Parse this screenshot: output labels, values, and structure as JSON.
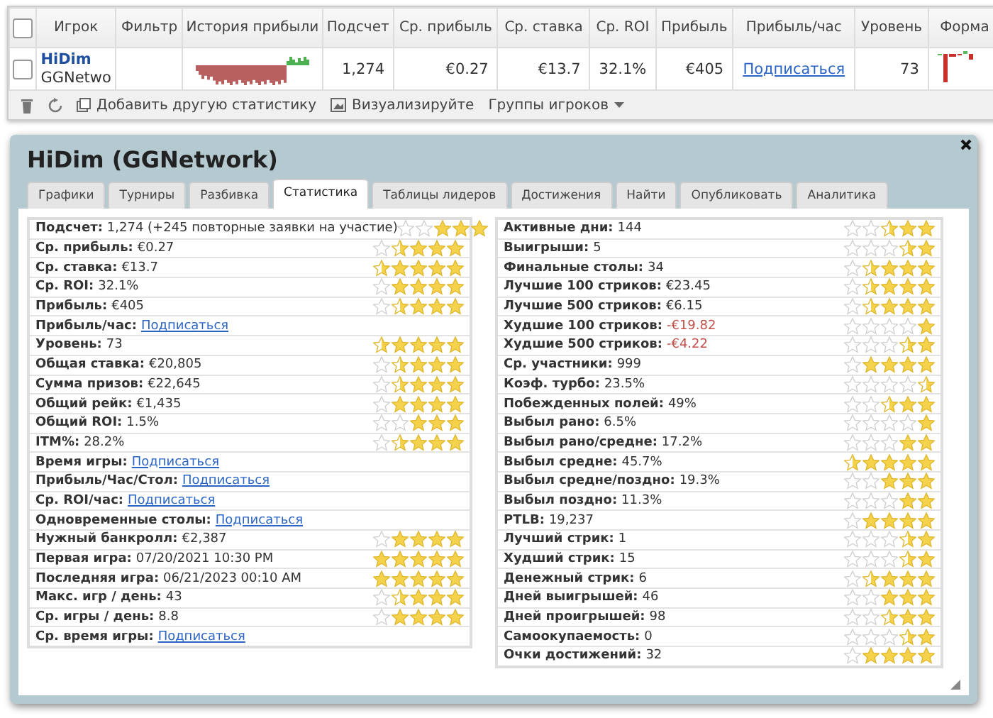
{
  "table": {
    "header_checked": false,
    "columns": [
      "Игрок",
      "Фильтр",
      "История прибыли",
      "Подсчет",
      "Ср. прибыль",
      "Ср. ставка",
      "Ср. ROI",
      "Прибыль",
      "Прибыль/час",
      "Уровень",
      "Форма"
    ],
    "row": {
      "checked": false,
      "player": "HiDim",
      "network": "GGNetwo",
      "count": "1,274",
      "avg_profit": "€0.27",
      "avg_stake": "€13.7",
      "avg_roi": "32.1%",
      "profit": "€405",
      "profit_per_hour": "Подписаться",
      "level": "73"
    }
  },
  "toolbar": {
    "add_stat": "Добавить другую статистику",
    "visualize": "Визуализируйте",
    "groups": "Группы игроков"
  },
  "dialog": {
    "title": "HiDim (GGNetwork)",
    "tabs": [
      {
        "label": "Графики",
        "selected": false
      },
      {
        "label": "Турниры",
        "selected": false
      },
      {
        "label": "Разбивка",
        "selected": false
      },
      {
        "label": "Статистика",
        "selected": true
      },
      {
        "label": "Таблицы лидеров",
        "selected": false
      },
      {
        "label": "Достижения",
        "selected": false
      },
      {
        "label": "Найти",
        "selected": false
      },
      {
        "label": "Опубликовать",
        "selected": false
      },
      {
        "label": "Аналитика",
        "selected": false
      }
    ],
    "left_stats": [
      {
        "label": "Подсчет:",
        "value": "1,274 (+245 повторные заявки на участие)",
        "negative": false,
        "stars": 3
      },
      {
        "label": "Ср. прибыль:",
        "value": "€0.27",
        "negative": false,
        "stars": 3.5
      },
      {
        "label": "Ср. ставка:",
        "value": "€13.7",
        "negative": false,
        "stars": 4.5
      },
      {
        "label": "Ср. ROI:",
        "value": "32.1%",
        "negative": false,
        "stars": 4
      },
      {
        "label": "Прибыль:",
        "value": "€405",
        "negative": false,
        "stars": 3.5
      },
      {
        "label": "Прибыль/час:",
        "link": "Подписаться"
      },
      {
        "label": "Уровень:",
        "value": "73",
        "negative": false,
        "stars": 4.5
      },
      {
        "label": "Общая ставка:",
        "value": "€20,805",
        "negative": false,
        "stars": 3.5
      },
      {
        "label": "Сумма призов:",
        "value": "€22,645",
        "negative": false,
        "stars": 3.5
      },
      {
        "label": "Общий рейк:",
        "value": "€1,435",
        "negative": false,
        "stars": 4
      },
      {
        "label": "Общий ROI:",
        "value": "1.5%",
        "negative": false,
        "stars": 3
      },
      {
        "label": "ITM%:",
        "value": "28.2%",
        "negative": false,
        "stars": 3.5
      },
      {
        "label": "Время игры:",
        "link": "Подписаться"
      },
      {
        "label": "Прибыль/Час/Стол:",
        "link": "Подписаться"
      },
      {
        "label": "Ср. ROI/час:",
        "link": "Подписаться"
      },
      {
        "label": "Одновременные столы:",
        "link": "Подписаться"
      },
      {
        "label": "Нужный банкролл:",
        "value": "€2,387",
        "negative": false,
        "stars": 4
      },
      {
        "label": "Первая игра:",
        "value": "07/20/2021 10:30 PM",
        "negative": false,
        "stars": 5
      },
      {
        "label": "Последняя игра:",
        "value": "06/21/2023 00:10 AM",
        "negative": false,
        "stars": 5
      },
      {
        "label": "Макс. игр / день:",
        "value": "43",
        "negative": false,
        "stars": 3.5
      },
      {
        "label": "Ср. игры / день:",
        "value": "8.8",
        "negative": false,
        "stars": 4
      },
      {
        "label": "Ср. время игры:",
        "link": "Подписаться"
      }
    ],
    "right_stats": [
      {
        "label": "Активные дни:",
        "value": "144",
        "negative": false,
        "stars": 2.5
      },
      {
        "label": "Выигрыши:",
        "value": "5",
        "negative": false,
        "stars": 1.5
      },
      {
        "label": "Финальные столы:",
        "value": "34",
        "negative": false,
        "stars": 3.5
      },
      {
        "label": "Лучшие 100 стриков:",
        "value": "€23.45",
        "negative": false,
        "stars": 3.5
      },
      {
        "label": "Лучшие 500 стриков:",
        "value": "€6.15",
        "negative": false,
        "stars": 3.5
      },
      {
        "label": "Худшие 100 стриков:",
        "value": "-€19.82",
        "negative": true,
        "stars": 1
      },
      {
        "label": "Худшие 500 стриков:",
        "value": "-€4.22",
        "negative": true,
        "stars": 1.5
      },
      {
        "label": "Ср. участники:",
        "value": "999",
        "negative": false,
        "stars": 4
      },
      {
        "label": "Коэф. турбо:",
        "value": "23.5%",
        "negative": false,
        "stars": 0.5
      },
      {
        "label": "Побежденных полей:",
        "value": "49%",
        "negative": false,
        "stars": 2.5
      },
      {
        "label": "Выбыл рано:",
        "value": "6.5%",
        "negative": false,
        "stars": 1
      },
      {
        "label": "Выбыл рано/средне:",
        "value": "17.2%",
        "negative": false,
        "stars": 2
      },
      {
        "label": "Выбыл средне:",
        "value": "45.7%",
        "negative": false,
        "stars": 4.5
      },
      {
        "label": "Выбыл средне/поздно:",
        "value": "19.3%",
        "negative": false,
        "stars": 3
      },
      {
        "label": "Выбыл поздно:",
        "value": "11.3%",
        "negative": false,
        "stars": 2
      },
      {
        "label": "PTLB:",
        "value": "19,237",
        "negative": false,
        "stars": 4
      },
      {
        "label": "Лучший стрик:",
        "value": "1",
        "negative": false,
        "stars": 1.5
      },
      {
        "label": "Худший стрик:",
        "value": "15",
        "negative": false,
        "stars": 1.5
      },
      {
        "label": "Денежный стрик:",
        "value": "6",
        "negative": false,
        "stars": 3.5
      },
      {
        "label": "Дней выигрышей:",
        "value": "46",
        "negative": false,
        "stars": 3
      },
      {
        "label": "Дней проигрышей:",
        "value": "98",
        "negative": false,
        "stars": 2.5
      },
      {
        "label": "Самоокупаемость:",
        "value": "0",
        "negative": false,
        "stars": 1.5
      },
      {
        "label": "Очки достижений:",
        "value": "32",
        "negative": false,
        "stars": 4
      }
    ]
  }
}
